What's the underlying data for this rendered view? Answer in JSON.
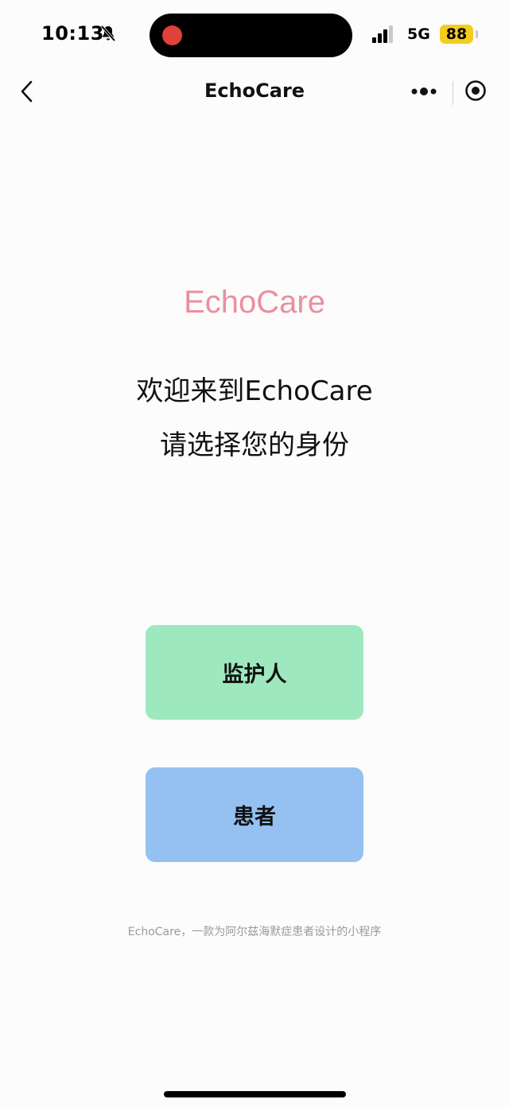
{
  "status_bar": {
    "time": "10:13",
    "network": "5G",
    "battery": "88",
    "icons": [
      "bell-mute-icon",
      "signal-icon"
    ],
    "battery_color": "#f4cd1c",
    "recording_color": "#e0413a"
  },
  "nav": {
    "title": "EchoCare",
    "icons": [
      "back-chevron-icon",
      "more-dots-icon",
      "target-circle-icon"
    ]
  },
  "main": {
    "brand": "EchoCare",
    "welcome": "欢迎来到EchoCare",
    "prompt": "请选择您的身份",
    "buttons": {
      "guardian_label": "监护人",
      "patient_label": "患者"
    },
    "footer": "EchoCare，一款为阿尔兹海默症患者设计的小程序"
  },
  "colors": {
    "brand": "#ec8ea0",
    "guardian_button": "#9ee8bf",
    "patient_button": "#94c1f1"
  }
}
